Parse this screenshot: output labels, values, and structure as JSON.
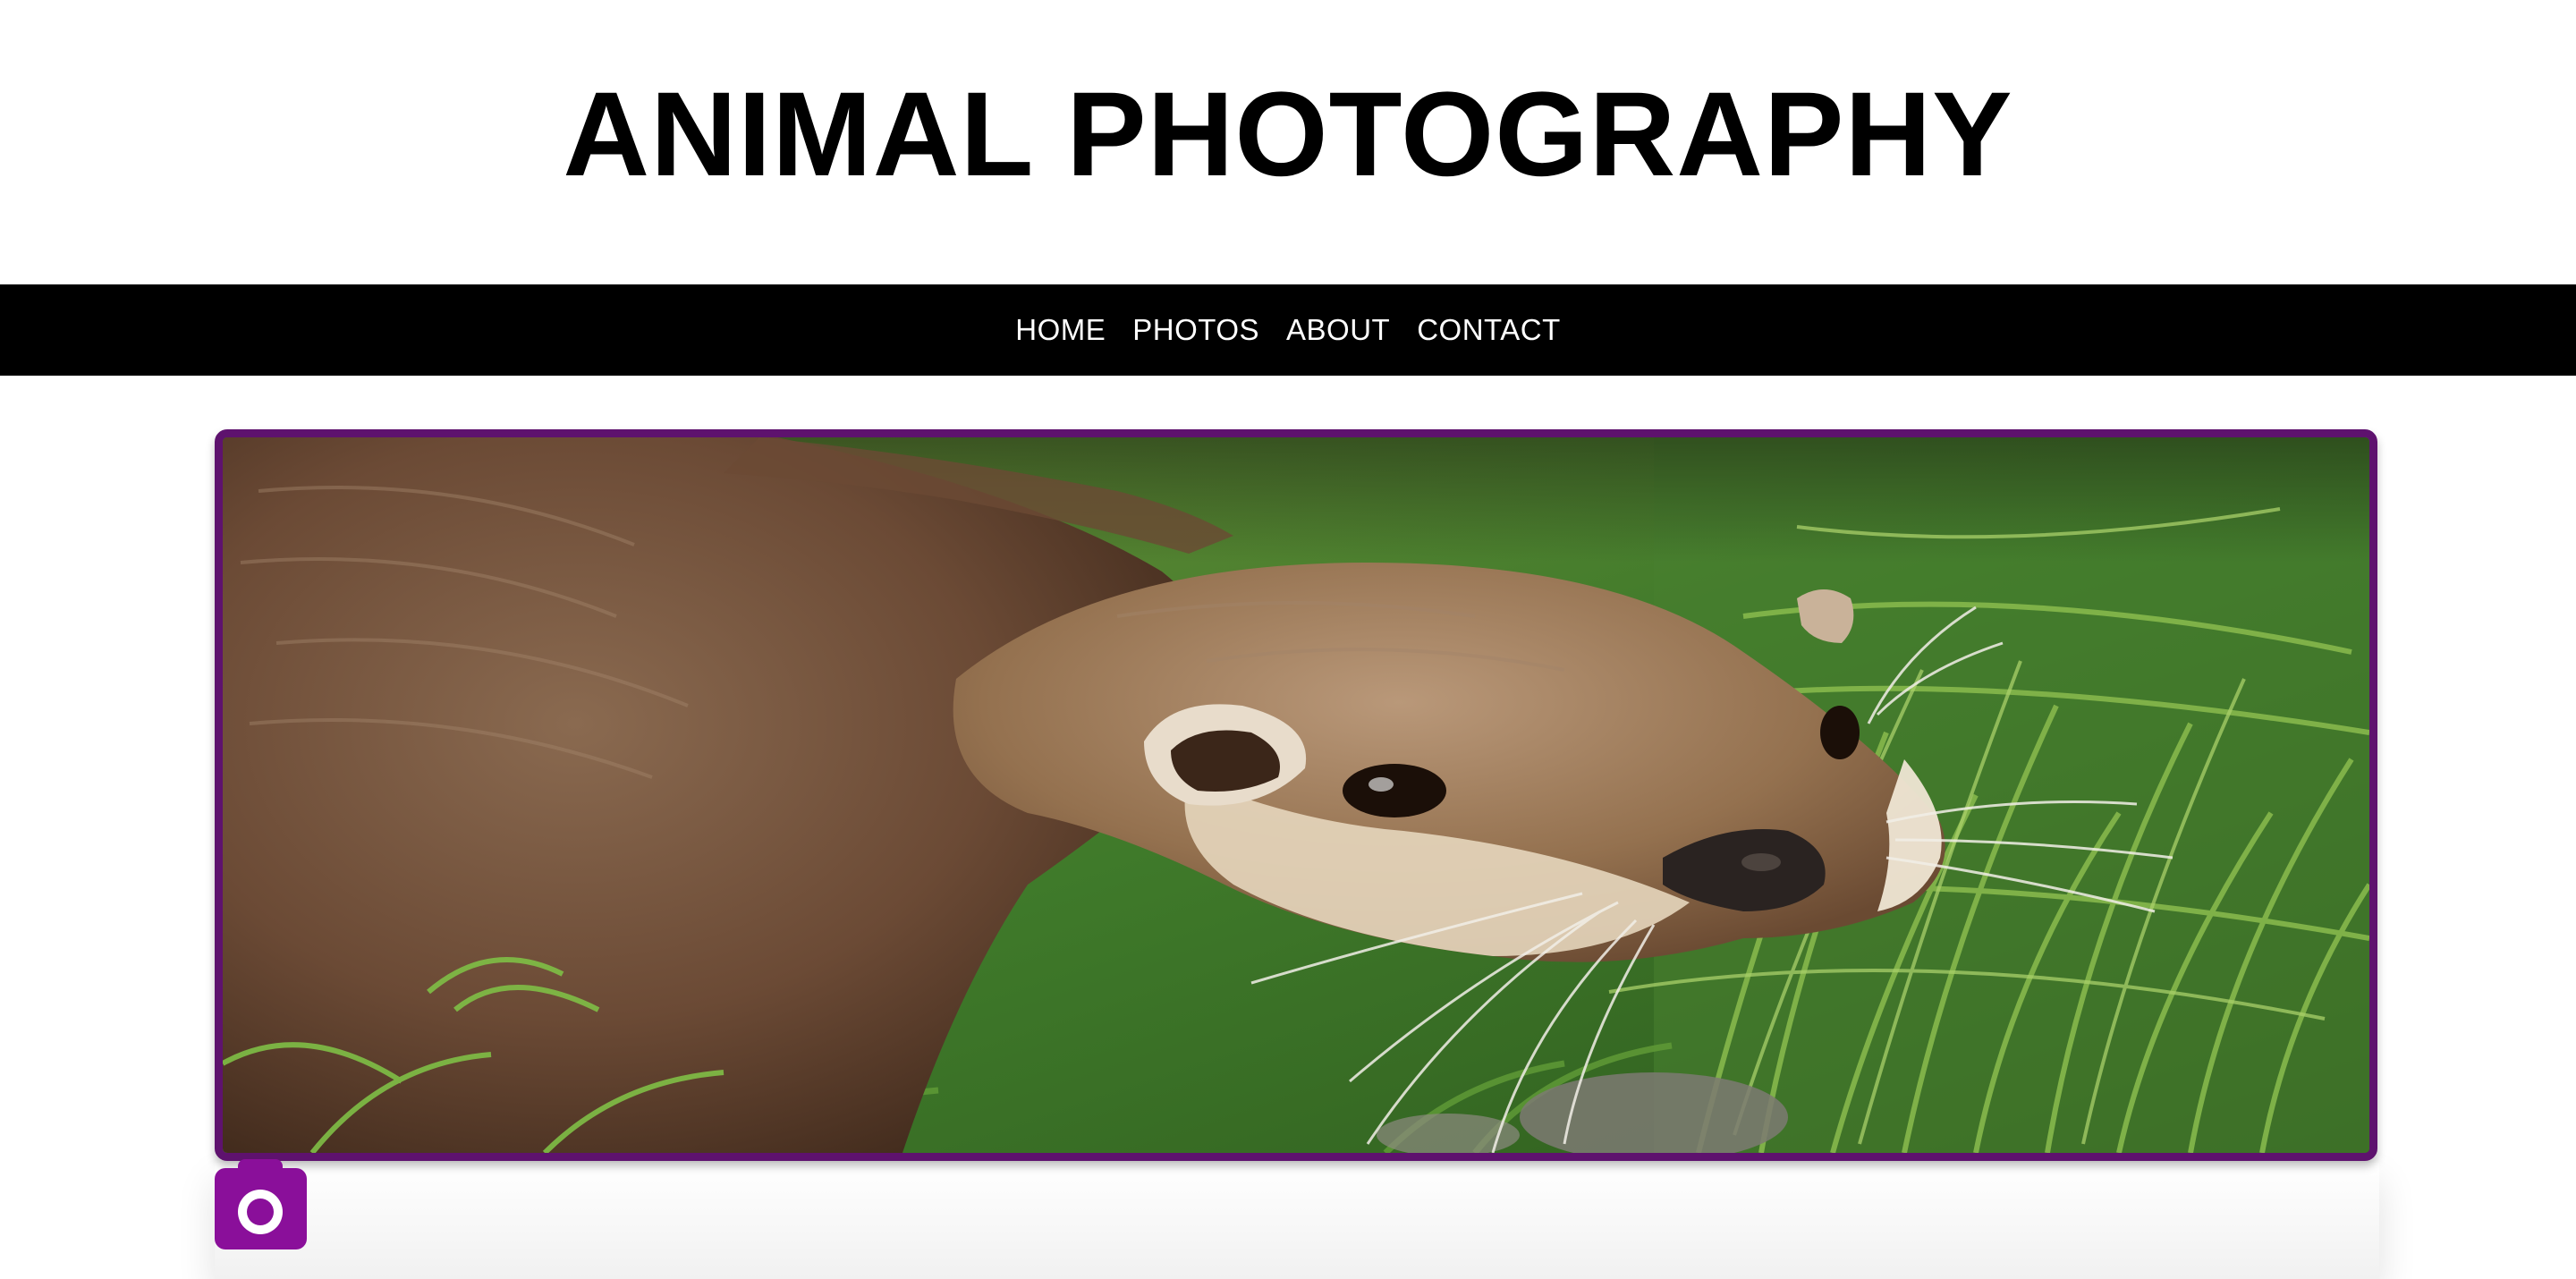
{
  "header": {
    "title": "ANIMAL PHOTOGRAPHY"
  },
  "nav": {
    "items": [
      {
        "label": "HOME"
      },
      {
        "label": "PHOTOS"
      },
      {
        "label": "ABOUT"
      },
      {
        "label": "CONTACT"
      }
    ]
  },
  "hero": {
    "subject": "otter-in-grass",
    "frame_color": "#5e126e"
  },
  "camera_button": {
    "icon": "camera-icon",
    "color": "#8a0f9a"
  }
}
